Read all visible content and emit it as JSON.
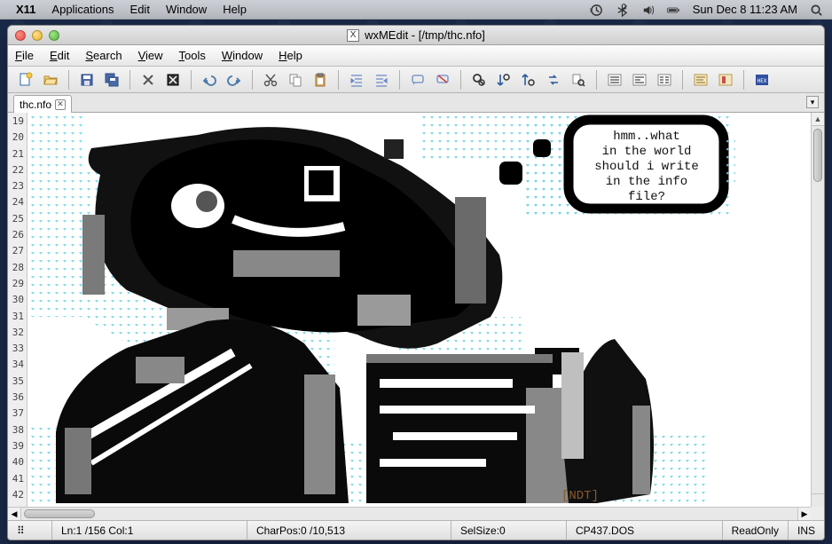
{
  "mac_menu": {
    "app": "X11",
    "items": [
      "Applications",
      "Edit",
      "Window",
      "Help"
    ],
    "clock": "Sun Dec 8  11:23 AM"
  },
  "window": {
    "title": "wxMEdit - [/tmp/thc.nfo]"
  },
  "app_menu": [
    "File",
    "Edit",
    "Search",
    "View",
    "Tools",
    "Window",
    "Help"
  ],
  "tab": {
    "label": "thc.nfo"
  },
  "gutter": {
    "start": 19,
    "end": 42
  },
  "bubble": {
    "l1": "hmm..what",
    "l2": "in the world",
    "l3": "should i write",
    "l4": "in the info",
    "l5": "file?"
  },
  "sig": "[NDT]",
  "status": {
    "pos": "Ln:1 /156 Col:1",
    "charpos": "CharPos:0 /10,513",
    "selsize": "SelSize:0",
    "encoding": "CP437.DOS",
    "readonly": "ReadOnly",
    "ins": "INS"
  }
}
